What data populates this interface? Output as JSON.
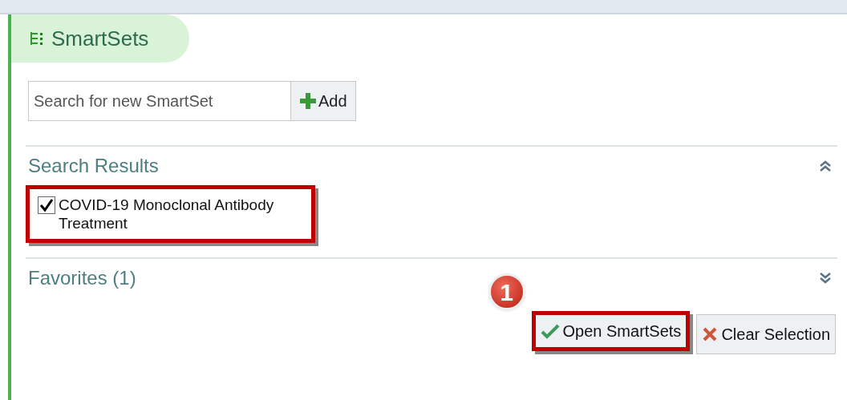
{
  "panel": {
    "title": "SmartSets"
  },
  "search": {
    "placeholder": "Search for new SmartSet",
    "add_button": "Add"
  },
  "sections": [
    {
      "title": "Search Results",
      "expanded": true,
      "results": [
        {
          "label": "COVID-19 Monoclonal Antibody Treatment",
          "checked": true,
          "highlighted": true
        }
      ]
    },
    {
      "title": "Favorites (1)",
      "expanded": false
    }
  ],
  "buttons": [
    {
      "kind": "open",
      "label": "Open SmartSets",
      "highlighted": true,
      "callout": "1"
    },
    {
      "kind": "clear",
      "label": "Clear Selection",
      "highlighted": false
    }
  ]
}
